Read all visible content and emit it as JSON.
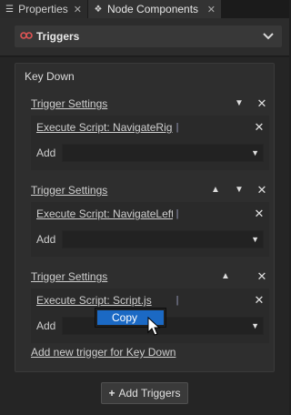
{
  "tabs": [
    {
      "label": "Properties",
      "icon": "list-icon",
      "active": false
    },
    {
      "label": "Node Components",
      "icon": "components-icon",
      "active": true
    }
  ],
  "panel": {
    "title": "Triggers",
    "icon": "triggers-icon"
  },
  "key_trigger": {
    "title": "Key Down",
    "trigger_settings": [
      {
        "label": "Trigger Settings",
        "buttons": [
          "move-down",
          "remove"
        ],
        "action": "Execute Script: NavigateRigh",
        "add_label": "Add"
      },
      {
        "label": "Trigger Settings",
        "buttons": [
          "move-up",
          "move-down",
          "remove"
        ],
        "action": "Execute Script: NavigateLeft.",
        "add_label": "Add"
      },
      {
        "label": "Trigger Settings",
        "buttons": [
          "move-up",
          "remove"
        ],
        "action": "Execute Script: Script.js",
        "add_label": "Add"
      }
    ],
    "add_trigger_link": "Add new trigger for Key Down"
  },
  "add_triggers_button": "Add Triggers",
  "context_menu": {
    "items": [
      "Copy"
    ]
  },
  "colors": {
    "accent": "#1b69c4",
    "trigger_icon": "#e05555"
  }
}
